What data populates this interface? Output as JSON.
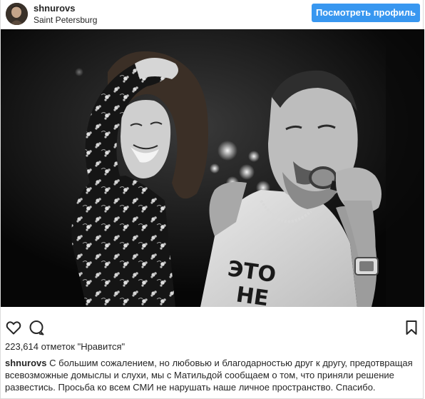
{
  "header": {
    "username": "shnurovs",
    "location": "Saint Petersburg",
    "view_profile_label": "Посмотреть профиль"
  },
  "photo": {
    "shirt_text_line1": "ЭТО",
    "shirt_text_line2": "НЕ"
  },
  "actions": {
    "like_icon": "heart-icon",
    "comment_icon": "comment-icon",
    "save_icon": "bookmark-icon"
  },
  "likes": {
    "text": "223,614 отметок \"Нравится\""
  },
  "caption": {
    "username": "shnurovs",
    "text": "С большим сожалением, но любовью и благодарностью друг к другу, предотвращая всевозможные домыслы и слухи, мы с Матильдой сообщаем о том, что приняли решение развестись. Просьба ко всем СМИ не нарушать наше личное пространство. Спасибо."
  },
  "colors": {
    "button_blue": "#3897f0",
    "text_dark": "#262626",
    "border": "#dbdbdb"
  }
}
